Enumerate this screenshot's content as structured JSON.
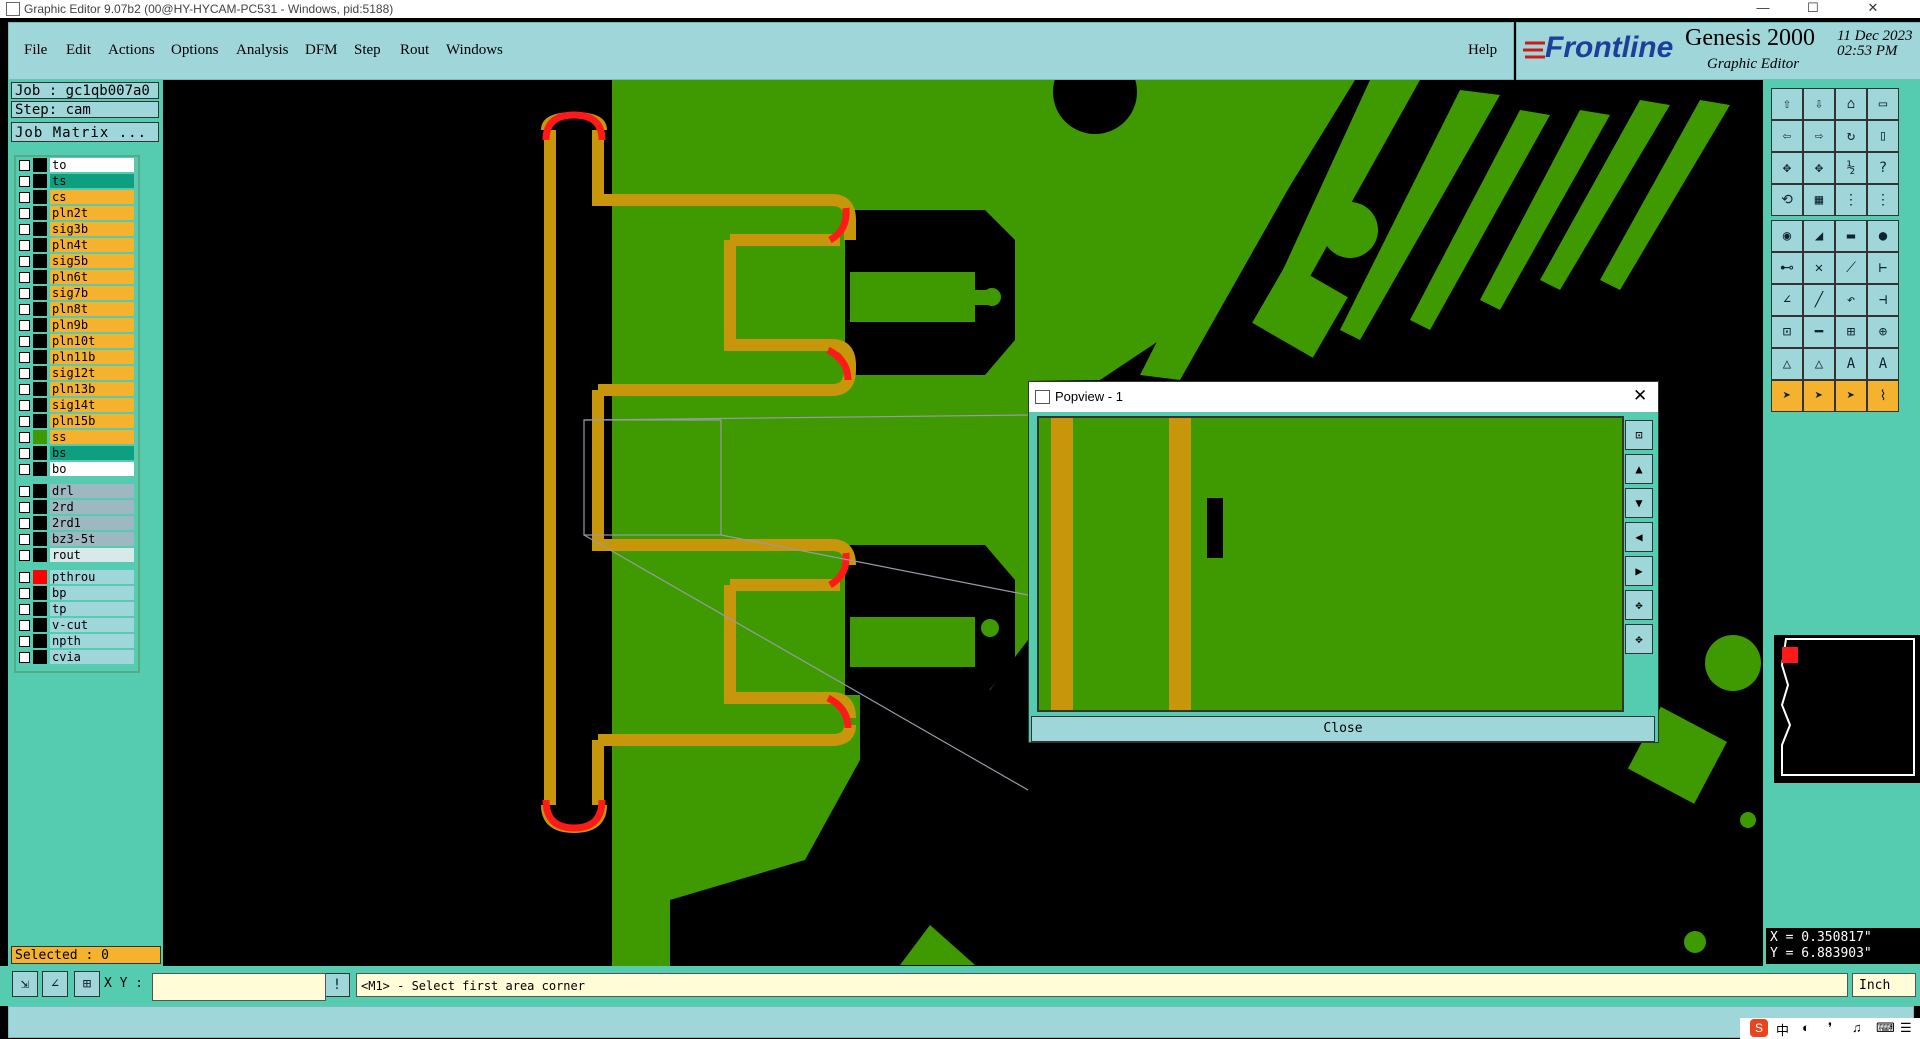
{
  "window": {
    "title": "Graphic Editor 9.07b2 (00@HY-HYCAM-PC531 - Windows, pid:5188)",
    "minimize": "—",
    "maximize": "☐",
    "close": "✕"
  },
  "menu": {
    "items": [
      "File",
      "Edit",
      "Actions",
      "Options",
      "Analysis",
      "DFM",
      "Step",
      "Rout",
      "Windows"
    ],
    "help": "Help"
  },
  "brand": {
    "logo": "Frontline",
    "product": "Genesis 2000",
    "subtitle": "Graphic Editor",
    "date": "11 Dec 2023",
    "time": "02:53 PM"
  },
  "job": {
    "job_label": "Job : gc1qb007a0",
    "step_label": "Step: cam",
    "matrix_button": "Job Matrix ..."
  },
  "layers": [
    {
      "name": "to",
      "color": "#ffffff",
      "swatch": "#000000"
    },
    {
      "name": "ts",
      "color": "#0e9e80",
      "swatch": "#000000"
    },
    {
      "name": "cs",
      "color": "#f5b22e",
      "swatch": "#000000"
    },
    {
      "name": "pln2t",
      "color": "#f5b22e",
      "swatch": "#000000"
    },
    {
      "name": "sig3b",
      "color": "#f5b22e",
      "swatch": "#000000"
    },
    {
      "name": "pln4t",
      "color": "#f5b22e",
      "swatch": "#000000"
    },
    {
      "name": "sig5b",
      "color": "#f5b22e",
      "swatch": "#000000"
    },
    {
      "name": "pln6t",
      "color": "#f5b22e",
      "swatch": "#000000"
    },
    {
      "name": "sig7b",
      "color": "#f5b22e",
      "swatch": "#000000"
    },
    {
      "name": "pln8t",
      "color": "#f5b22e",
      "swatch": "#000000"
    },
    {
      "name": "pln9b",
      "color": "#f5b22e",
      "swatch": "#000000"
    },
    {
      "name": "pln10t",
      "color": "#f5b22e",
      "swatch": "#000000"
    },
    {
      "name": "pln11b",
      "color": "#f5b22e",
      "swatch": "#000000"
    },
    {
      "name": "sig12t",
      "color": "#f5b22e",
      "swatch": "#000000"
    },
    {
      "name": "pln13b",
      "color": "#f5b22e",
      "swatch": "#000000"
    },
    {
      "name": "sig14t",
      "color": "#f5b22e",
      "swatch": "#000000"
    },
    {
      "name": "pln15b",
      "color": "#f5b22e",
      "swatch": "#000000"
    },
    {
      "name": "ss",
      "color": "#f5b22e",
      "swatch": "#3f9900"
    },
    {
      "name": "bs",
      "color": "#0e9e80",
      "swatch": "#000000"
    },
    {
      "name": "bo",
      "color": "#ffffff",
      "swatch": "#000000"
    }
  ],
  "drill_layers": [
    {
      "name": "drl",
      "color": "#9db8c0",
      "swatch": "#000000"
    },
    {
      "name": "2rd",
      "color": "#9db8c0",
      "swatch": "#000000"
    },
    {
      "name": "2rd1",
      "color": "#9db8c0",
      "swatch": "#000000"
    },
    {
      "name": "bz3-5t",
      "color": "#9db8c0",
      "swatch": "#000000"
    },
    {
      "name": "rout",
      "color": "#d9e8e8",
      "swatch": "#000000"
    }
  ],
  "other_layers": [
    {
      "name": "pthrou",
      "color": "#9fd6d9",
      "swatch": "#ff0000"
    },
    {
      "name": "bp",
      "color": "#9fd6d9",
      "swatch": "#000000"
    },
    {
      "name": "tp",
      "color": "#9fd6d9",
      "swatch": "#000000"
    },
    {
      "name": "v-cut",
      "color": "#9fd6d9",
      "swatch": "#000000"
    },
    {
      "name": "npth",
      "color": "#9fd6d9",
      "swatch": "#000000"
    },
    {
      "name": "cvia",
      "color": "#9fd6d9",
      "swatch": "#000000"
    }
  ],
  "selected": "Selected : 0",
  "popview": {
    "title": "Popview - 1",
    "close_button": "Close"
  },
  "coordinates": {
    "x": "X = 0.350817\"",
    "y": "Y = 6.883903\""
  },
  "command": {
    "xy_label": "X Y :",
    "xy_value": "",
    "prompt": "<M1> - Select first area corner",
    "unit": "Inch"
  },
  "tray": {
    "ime": "中"
  },
  "colors": {
    "board_green": "#3f9900",
    "gold": "#c8960a",
    "red_highlight": "#ff1a1a",
    "panel_teal": "#55cbaf",
    "panel_light": "#9fd6d9"
  }
}
